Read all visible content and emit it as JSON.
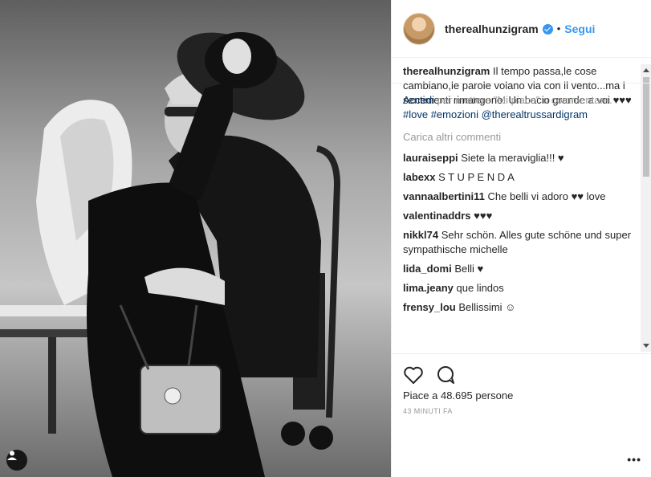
{
  "post": {
    "username": "therealhunzigram",
    "follow_label": "Segui",
    "caption_user": "therealhunzigram",
    "caption_text": "Il tempo passa,le cose cambiano,le parole volano via con il vento...ma i sentimenti rimangono. Un bacio grande a voi ♥♥♥ ",
    "caption_hashtag_1": "#love",
    "caption_hashtag_2": "#emozioni",
    "caption_mention": "@therealtrussardigram",
    "load_more": "Carica altri commenti",
    "comments": [
      {
        "user": "lauraiseppi",
        "text": "Siete la meraviglia!!! ♥"
      },
      {
        "user": "labexx",
        "text": "S T U P E N D A"
      },
      {
        "user": "vannaalbertini11",
        "text": "Che belli vi adoro ♥♥ love"
      },
      {
        "user": "valentinaddrs",
        "text": "♥♥♥"
      },
      {
        "user": "nikkl74",
        "text": "Sehr schön. Alles gute schöne und super sympathische michelle"
      },
      {
        "user": "lida_domi",
        "text": "Belli ♥"
      },
      {
        "user": "lima.jeany",
        "text": "que lindos"
      },
      {
        "user": "frensy_lou",
        "text": "Bellissimi ☺"
      }
    ],
    "likes": "Piace a 48.695 persone",
    "timestamp": "43 minuti fa",
    "login_link": "Accedi",
    "login_text": " per mettere \"Mi piace\" o commentare.",
    "more_dots": "•••"
  },
  "icons": {
    "like": "heart-icon",
    "comment": "comment-bubble-icon",
    "tag": "person-tag-icon",
    "verified": "verified-badge-icon"
  },
  "colors": {
    "link_blue": "#3897f0",
    "hashtag": "#003569",
    "muted": "#999999"
  }
}
